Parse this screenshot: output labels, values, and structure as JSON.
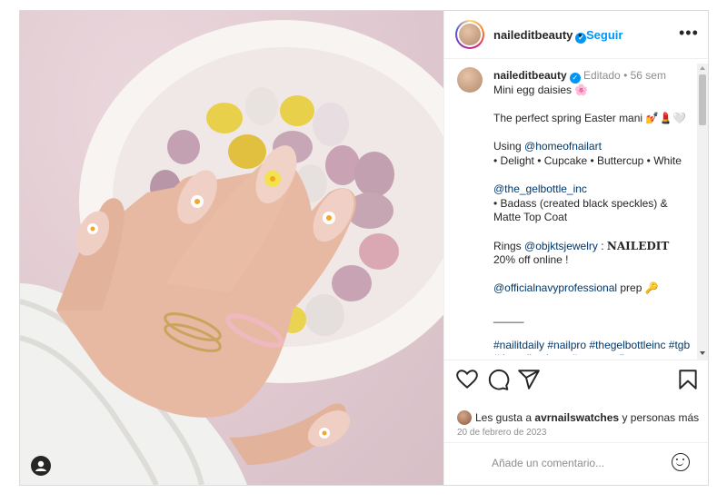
{
  "header": {
    "username": "naileditbeauty",
    "separator": "•",
    "follow_label": "Seguir",
    "more_label": "•••"
  },
  "caption": {
    "username": "naileditbeauty",
    "edited": "Editado",
    "separator": "•",
    "time_ago": "56 sem",
    "line1": "Mini egg daisies 🌸",
    "line2": "The perfect spring Easter mani 💅💄🤍",
    "line3_prefix": "Using ",
    "line3_link": "@homeofnailart",
    "line4": "• Delight • Cupcake • Buttercup • White",
    "line5_link": "@the_gelbottle_inc",
    "line6": "• Badass (created black speckles) & Matte Top Coat",
    "line7_prefix": "Rings ",
    "line7_link": "@objktsjewelry",
    "line7_sep": " : ",
    "line7_brand": "NAILEDIT",
    "line7_suffix": " 20% off online !",
    "line8_link": "@officialnavyprofessional",
    "line8_suffix": " prep 🔑",
    "line9": "_____",
    "hashtags": "#nailitdaily #nailpro #thegelbottleinc #tgb #thenailtechorg #easternails"
  },
  "likes": {
    "prefix": "Les gusta a ",
    "user": "avrnailswatches",
    "suffix": " y personas más"
  },
  "date": "20 de febrero de 2023",
  "comment": {
    "placeholder": "Añade un comentario..."
  },
  "icons": [
    "heart-icon",
    "comment-icon",
    "share-icon",
    "bookmark-icon",
    "emoji-icon",
    "more-options-icon",
    "verified-icon",
    "user-tag-icon"
  ],
  "colors": {
    "accent": "#0095f6",
    "link": "#00376b",
    "muted": "#8e8e8e",
    "text": "#262626"
  }
}
